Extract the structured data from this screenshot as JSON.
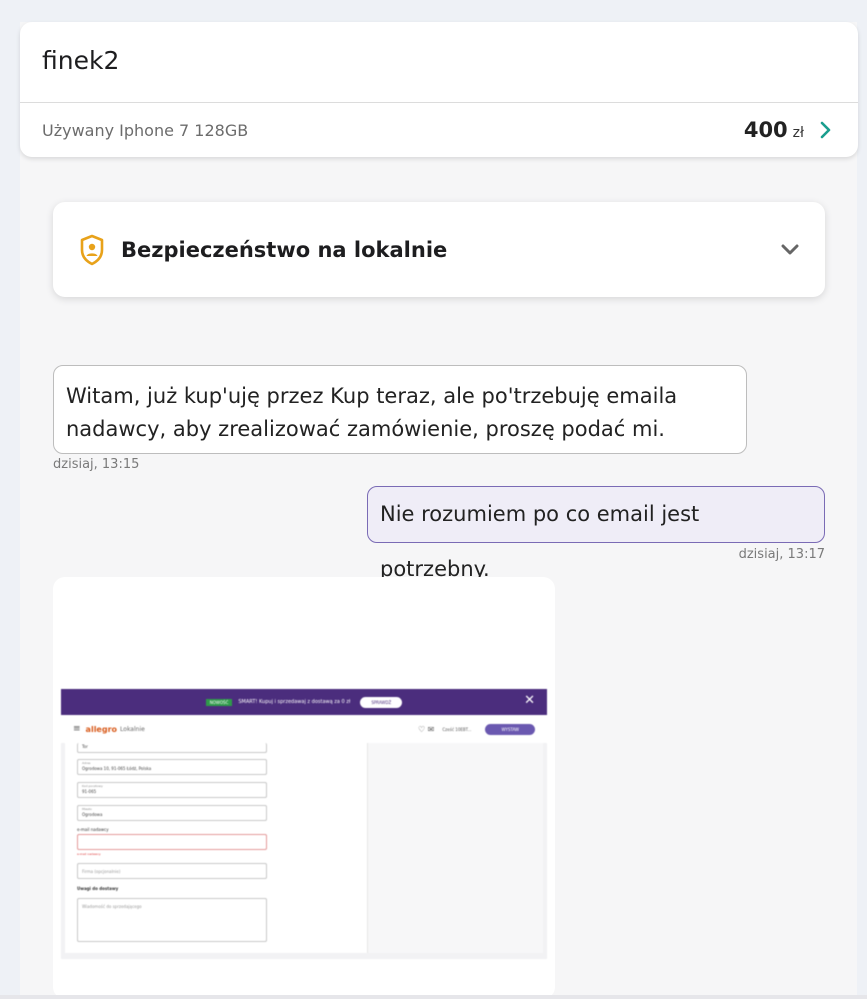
{
  "header": {
    "username": "finek2",
    "listing_title": "Używany Iphone 7 128GB",
    "price_value": "400",
    "price_currency": "zł"
  },
  "safety": {
    "title": "Bezpieczeństwo na lokalnie"
  },
  "messages": [
    {
      "direction": "incoming",
      "text": "Witam, już kup'uję przez Kup teraz, ale po'trzebuję emaila nadawcy, aby zrealizować zamówienie, proszę podać mi.",
      "time": "dzisiaj, 13:15"
    },
    {
      "direction": "outgoing",
      "text": "Nie rozumiem po co email jest potrzebny.",
      "time": "dzisiaj, 13:17"
    }
  ],
  "attachment": {
    "banner_badge": "NOWOŚĆ",
    "banner_text": "SMART! Kupuj i sprzedawaj z dostawą za 0 zł",
    "banner_button": "SPRAWDŹ",
    "logo": "allegro",
    "logo_sub": "Lokalnie",
    "user": "Cześć 10EBT...",
    "cta": "WYSTAW",
    "fields": [
      {
        "label": "",
        "value": "Tor"
      },
      {
        "label": "Adres",
        "value": "Ogrodowa 10, 91-065 Łódź, Polska"
      },
      {
        "label": "Kod pocztowy",
        "value": "91-065"
      },
      {
        "label": "Miasto",
        "value": "Ogrodowa"
      }
    ],
    "email_label": "e-mail nadawcy",
    "email_error": "e-mail nadawcy",
    "optional_placeholder": "Firma (opcjonalnie)",
    "notes_label": "Uwagi do dostawy",
    "notes_placeholder": "Wiadomość do sprzedającego"
  },
  "colors": {
    "accent_green": "#1a9e8e",
    "shield_gold": "#e8a21a",
    "outgoing_border": "#7a6bb5",
    "outgoing_bg": "#efedf7"
  }
}
